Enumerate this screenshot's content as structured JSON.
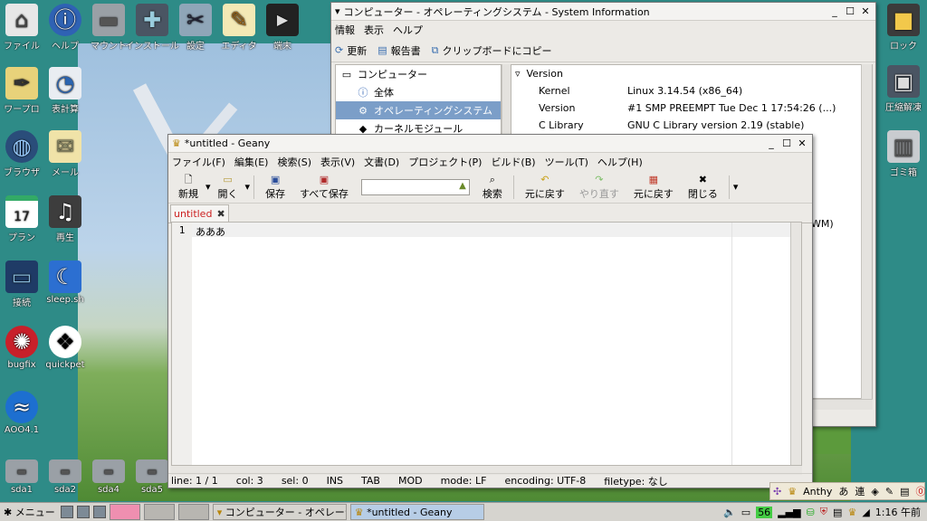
{
  "desktop_icons_left": [
    {
      "name": "file-manager",
      "label": "ファイル",
      "icon": "house-icon",
      "glyph": "⌂"
    },
    {
      "name": "help",
      "label": "ヘルプ",
      "icon": "info-icon",
      "glyph": "ⓘ"
    },
    {
      "name": "mount",
      "label": "マウント",
      "icon": "drive-icon",
      "glyph": "▬"
    },
    {
      "name": "install",
      "label": "インストール",
      "icon": "install-box-icon",
      "glyph": "✚"
    },
    {
      "name": "settings",
      "label": "設定",
      "icon": "tools-icon",
      "glyph": "✂"
    },
    {
      "name": "editor",
      "label": "エディタ",
      "icon": "notepad-icon",
      "glyph": "✎"
    },
    {
      "name": "terminal",
      "label": "端末",
      "icon": "terminal-icon",
      "glyph": "▶"
    }
  ],
  "desktop_icons_col": [
    {
      "name": "wordpro",
      "label": "ワープロ",
      "icon": "pen-icon",
      "glyph": "✒"
    },
    {
      "name": "spreadsheet",
      "label": "表計算",
      "icon": "chart-icon",
      "glyph": "◔"
    },
    {
      "name": "browser",
      "label": "ブラウザ",
      "icon": "globe-icon",
      "glyph": "◍"
    },
    {
      "name": "mail",
      "label": "メール",
      "icon": "envelope-icon",
      "glyph": "✉"
    },
    {
      "name": "plan",
      "label": "プラン",
      "icon": "calendar-icon",
      "glyph": "17"
    },
    {
      "name": "play",
      "label": "再生",
      "icon": "music-icon",
      "glyph": "♫"
    },
    {
      "name": "connect",
      "label": "接続",
      "icon": "network-icon",
      "glyph": "▭"
    },
    {
      "name": "sleep",
      "label": "sleep.sh",
      "icon": "moon-icon",
      "glyph": "☾"
    },
    {
      "name": "bugfix",
      "label": "bugfix",
      "icon": "bug-icon",
      "glyph": "✺"
    },
    {
      "name": "quickpet",
      "label": "quickpet",
      "icon": "dog-icon",
      "glyph": "❖"
    },
    {
      "name": "aoo",
      "label": "AOO4.1",
      "icon": "seagull-icon",
      "glyph": "≈"
    }
  ],
  "drives": [
    {
      "name": "sda1",
      "label": "sda1"
    },
    {
      "name": "sda2",
      "label": "sda2"
    },
    {
      "name": "sda4",
      "label": "sda4"
    },
    {
      "name": "sda5",
      "label": "sda5"
    }
  ],
  "desktop_icons_right": [
    {
      "name": "lock",
      "label": "ロック",
      "icon": "padlock-icon",
      "glyph": "🔒"
    },
    {
      "name": "archiver",
      "label": "圧縮解凍",
      "icon": "archive-icon",
      "glyph": "▣"
    },
    {
      "name": "trash",
      "label": "ゴミ箱",
      "icon": "trash-icon",
      "glyph": "🗑"
    }
  ],
  "sysinfo": {
    "title": "コンピューター - オペレーティングシステム - System Information",
    "menu": [
      "情報",
      "表示",
      "ヘルプ"
    ],
    "toolbar": {
      "refresh": "更新",
      "report": "報告書",
      "copy": "クリップボードにコピー"
    },
    "tree": [
      {
        "label": "コンピューター",
        "level": 0,
        "selected": false
      },
      {
        "label": "全体",
        "level": 1,
        "selected": false
      },
      {
        "label": "オペレーティングシステム",
        "level": 1,
        "selected": true
      },
      {
        "label": "カーネルモジュール",
        "level": 1,
        "selected": false
      }
    ],
    "section": "Version",
    "rows": [
      {
        "key": "Kernel",
        "value": "Linux 3.14.54 (x86_64)"
      },
      {
        "key": "Version",
        "value": "#1 SMP PREEMPT Tue Dec 1 17:54:26 (...)"
      },
      {
        "key": "C Library",
        "value": "GNU C Library version 2.19 (stable)"
      }
    ],
    "partial_text": "WM)"
  },
  "geany": {
    "title": "*untitled - Geany",
    "menu": [
      "ファイル(F)",
      "編集(E)",
      "検索(S)",
      "表示(V)",
      "文書(D)",
      "プロジェクト(P)",
      "ビルド(B)",
      "ツール(T)",
      "ヘルプ(H)"
    ],
    "toolbar": {
      "new": "新規",
      "open": "開く",
      "save": "保存",
      "save_all": "すべて保存",
      "search": "検索",
      "revert": "元に戻す",
      "redo": "やり直す",
      "revert2": "元に戻す",
      "close": "閉じる"
    },
    "tab": "untitled",
    "line_number": "1",
    "content": "あああ",
    "status": {
      "line": "line: 1 / 1",
      "col": "col: 3",
      "sel": "sel: 0",
      "ins": "INS",
      "tab": "TAB",
      "mod": "MOD",
      "mode": "mode: LF",
      "encoding": "encoding: UTF-8",
      "filetype": "filetype: なし"
    }
  },
  "anthy": {
    "name": "Anthy",
    "mode": "あ",
    "conv": "連"
  },
  "taskbar": {
    "menu": "メニュー",
    "tasks": [
      {
        "label": "コンピューター - オペレーテ",
        "active": false
      },
      {
        "label": "*untitled - Geany",
        "active": true
      }
    ],
    "tray_number": "56",
    "clock": "1:16 午前"
  }
}
